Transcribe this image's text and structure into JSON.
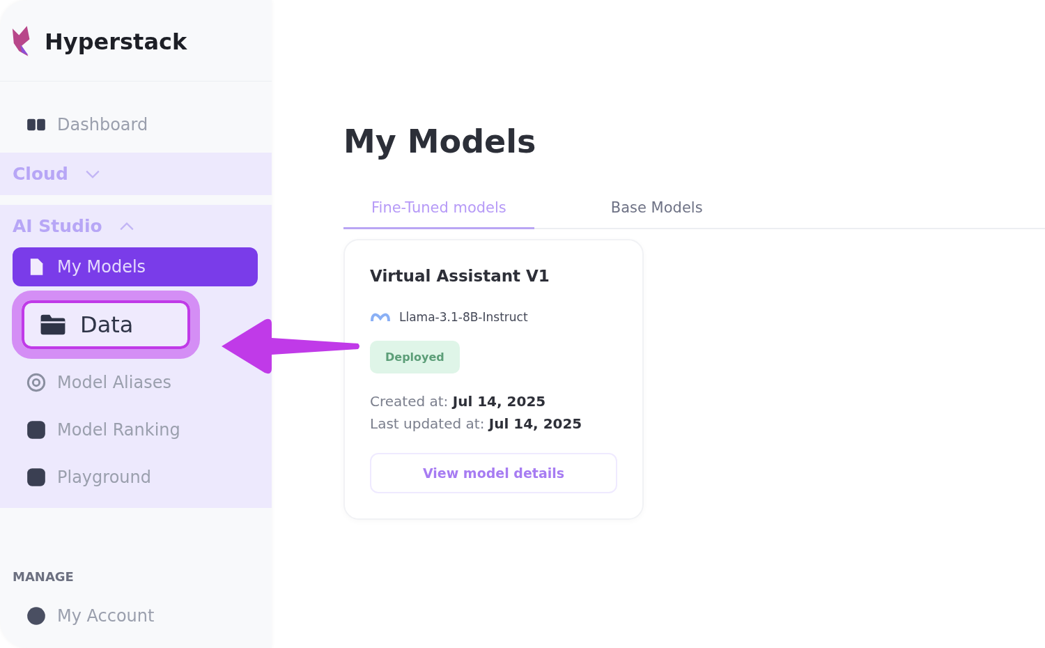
{
  "brand": {
    "name": "Hyperstack"
  },
  "sidebar": {
    "items": [
      {
        "label": "Dashboard"
      }
    ],
    "sections": [
      {
        "label": "Cloud",
        "expanded": false
      },
      {
        "label": "AI Studio",
        "expanded": true,
        "items": [
          {
            "label": "My Models",
            "selected": true,
            "highlighted": false
          },
          {
            "label": "Data",
            "selected": false,
            "highlighted": true
          },
          {
            "label": "Model Aliases",
            "selected": false,
            "highlighted": false
          },
          {
            "label": "Model Ranking",
            "selected": false,
            "highlighted": false
          },
          {
            "label": "Playground",
            "selected": false,
            "highlighted": false
          }
        ]
      }
    ],
    "manage": {
      "heading": "MANAGE",
      "items": [
        {
          "label": "My Account"
        }
      ]
    }
  },
  "page": {
    "title": "My Models"
  },
  "tabs": [
    {
      "label": "Fine-Tuned models",
      "selected": true
    },
    {
      "label": "Base Models",
      "selected": false
    }
  ],
  "cards": [
    {
      "title": "Virtual Assistant V1",
      "base_model": "Llama-3.1-8B-Instruct",
      "status": "Deployed",
      "created": "Created at: **Jul 14, 2025**",
      "updated": "Last updated at: **Jul 14, 2025**",
      "action": "View model details"
    }
  ]
}
